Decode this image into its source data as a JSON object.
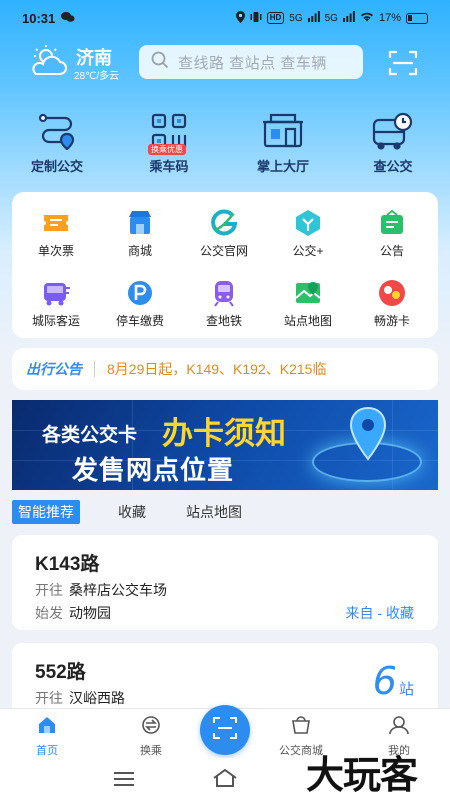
{
  "status_bar": {
    "time": "10:31",
    "network_1": "5G",
    "network_2": "5G",
    "hd": "HD",
    "battery": "17%"
  },
  "header": {
    "city": "济南",
    "weather": "28℃/多云"
  },
  "search": {
    "placeholder": "查线路 查站点 查车辆"
  },
  "quick_actions": [
    {
      "label": "定制公交",
      "icon": "custom-bus-icon"
    },
    {
      "label": "乘车码",
      "icon": "qr-code-icon",
      "tag": "换乘优惠"
    },
    {
      "label": "掌上大厅",
      "icon": "service-hall-icon"
    },
    {
      "label": "查公交",
      "icon": "bus-clock-icon"
    }
  ],
  "services": [
    {
      "label": "单次票",
      "icon": "ticket-icon",
      "color": "#ff9f1a"
    },
    {
      "label": "商城",
      "icon": "shop-icon",
      "color": "#2d8cf0"
    },
    {
      "label": "公交官网",
      "icon": "official-site-icon",
      "color": "#1ab0c8"
    },
    {
      "label": "公交+",
      "icon": "bus-plus-icon",
      "color": "#2ec6d6"
    },
    {
      "label": "公告",
      "icon": "announcement-icon",
      "color": "#2bbf6a"
    },
    {
      "label": "城际客运",
      "icon": "intercity-icon",
      "color": "#7a5cf0"
    },
    {
      "label": "停车缴费",
      "icon": "parking-icon",
      "color": "#2d8cf0"
    },
    {
      "label": "查地铁",
      "icon": "metro-icon",
      "color": "#8a5ce8"
    },
    {
      "label": "站点地图",
      "icon": "station-map-icon",
      "color": "#2bbf6a"
    },
    {
      "label": "畅游卡",
      "icon": "tour-card-icon",
      "color": "#f34848"
    }
  ],
  "notice": {
    "brand": "出行公告",
    "text": "8月29日起，K149、K192、K215临"
  },
  "banner": {
    "line1_a": "各类公交卡",
    "line1_b": "办卡须知",
    "line2": "发售网点位置"
  },
  "tabs": [
    "智能推荐",
    "收藏",
    "站点地图"
  ],
  "routes": [
    {
      "name": "K143路",
      "to_label": "开往",
      "to": "桑梓店公交车场",
      "from_label": "始发",
      "from": "动物园",
      "action": "来自 - 收藏"
    },
    {
      "name": "552路",
      "to_label": "开往",
      "to": "汉峪西路",
      "stops": "6",
      "stops_unit": "站"
    }
  ],
  "bottom_nav": [
    {
      "label": "首页",
      "icon": "home-icon"
    },
    {
      "label": "换乘",
      "icon": "transfer-icon"
    },
    {
      "label": "",
      "icon": "scan-icon"
    },
    {
      "label": "公交商城",
      "icon": "mall-icon"
    },
    {
      "label": "我的",
      "icon": "profile-icon"
    }
  ],
  "watermark": "大玩客",
  "colors": {
    "accent": "#2d8cf0",
    "notice": "#e08a1e"
  }
}
